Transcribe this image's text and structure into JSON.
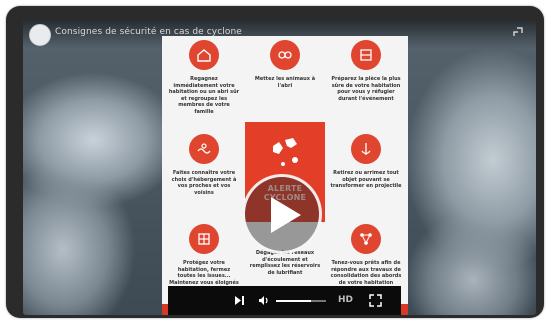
{
  "video": {
    "title": "Consignes de sécurité en cas de cyclone",
    "channel": "channel-avatar",
    "volume_fraction": 0.7,
    "quality_label": "HD"
  },
  "poster": {
    "items": [
      {
        "icon": "house-icon",
        "text": "Regagnez immédiatement votre habitation ou un abri sûr et regroupez les membres de votre famille"
      },
      {
        "icon": "animal-icon",
        "text": "Mettez les animaux à l'abri"
      },
      {
        "icon": "room-icon",
        "text": "Préparez la pièce la plus sûre de votre habitation pour vous y réfugier durant l'événement"
      },
      {
        "icon": "sea-icon",
        "text": "Faites connaître votre choix d'hébergement à vos proches et vos voisins"
      },
      {
        "icon": "anchor-icon",
        "text": "Retirez ou arrimez tout objet pouvant se transformer en projectile"
      },
      {
        "icon": "window-icon",
        "text": "Protégez votre habitation, fermez toutes les issues... Maintenez vous éloignés des baies vitrées pendant l'événement"
      },
      {
        "icon": "tools-icon",
        "text": "Dégagez les réseaux d'écoulement et remplissez les réservoirs de lubrifiant"
      },
      {
        "icon": "network-icon",
        "text": "Tenez-vous prêts afin de répondre aux travaux de consolidation des abords de votre habitation"
      }
    ],
    "alert_text": "ALERTE CYCLONE"
  },
  "colors": {
    "accent_red": "#e23e28",
    "frame": "#2b2b2b"
  }
}
